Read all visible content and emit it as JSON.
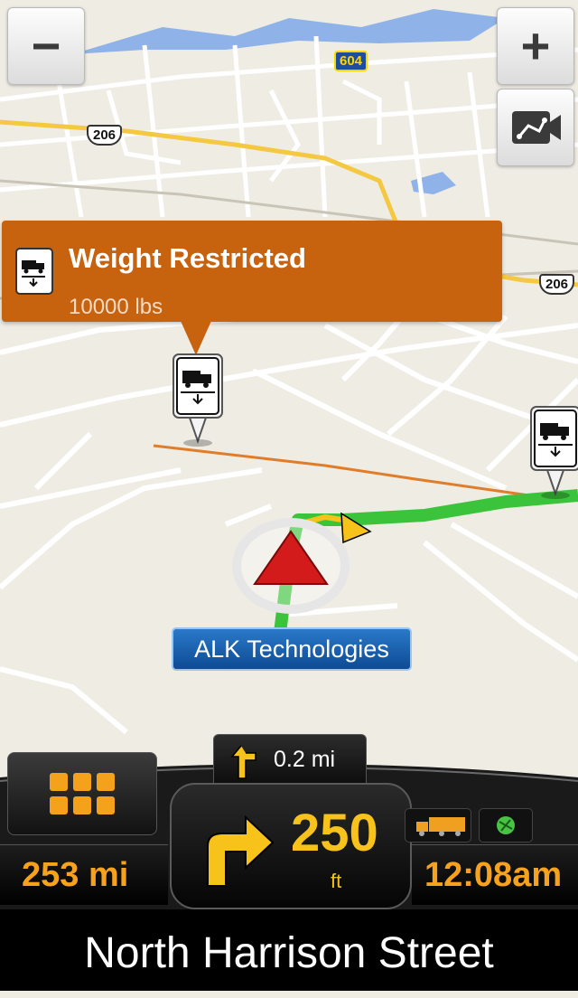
{
  "map": {
    "shields": [
      {
        "label": "206",
        "kind": "us-route"
      },
      {
        "label": "604",
        "kind": "highway"
      },
      {
        "label": "206",
        "kind": "us-route"
      }
    ],
    "poi_label": "ALK Technologies"
  },
  "controls": {
    "zoom_out_icon": "minus-icon",
    "zoom_in_icon": "plus-icon",
    "camera_icon": "route-camera-icon"
  },
  "callout": {
    "title": "Weight Restricted",
    "subtitle": "10000 lbs",
    "icon": "truck-weight-icon"
  },
  "dashboard": {
    "menu_icon": "grid-menu-icon",
    "next_turn_distance": "0.2 mi",
    "next_turn_icon": "turn-left-arrow-icon",
    "turn_distance": "250",
    "turn_unit": "ft",
    "turn_icon": "turn-right-arrow-icon",
    "total_distance": "253 mi",
    "time": "12:08am",
    "truck_status_icon": "truck-icon",
    "gps_status_icon": "gps-icon"
  },
  "street_name": "North Harrison Street",
  "colors": {
    "accent": "#f7a21c",
    "callout": "#c7620e",
    "route": "#3bc43b",
    "poi_label": "#1a5eaa"
  }
}
